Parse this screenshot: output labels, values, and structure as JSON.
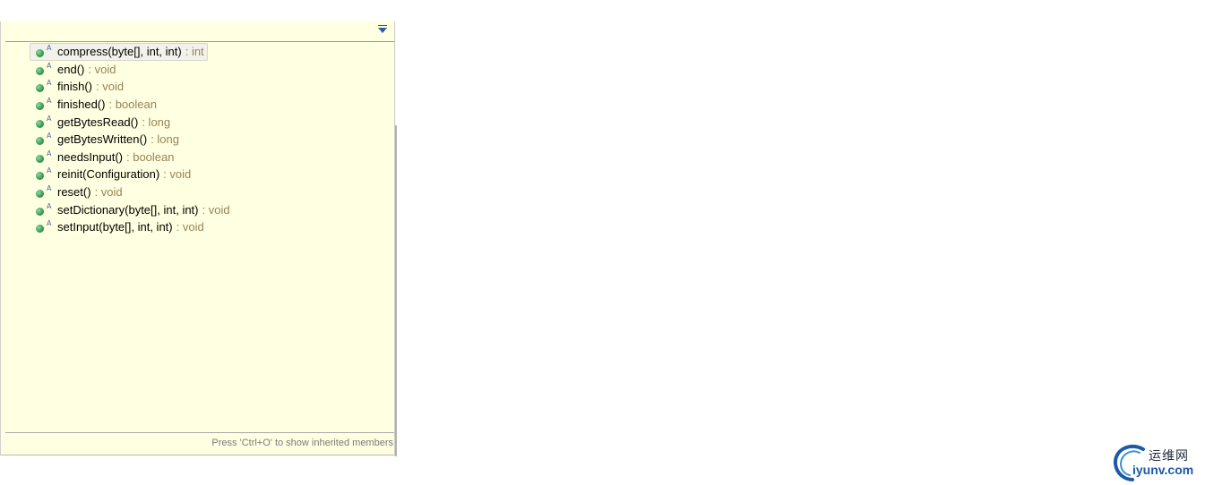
{
  "outline": {
    "filter_value": "",
    "view_menu_icon": "chevron-down-icon",
    "method_icon": "public-method-icon",
    "abstract_marker": "A",
    "colors": {
      "background": "#ffffe1",
      "return_type": "#96845a",
      "method_icon": "#3c9d58"
    },
    "methods": [
      {
        "signature": "compress(byte[], int, int)",
        "return": ": int",
        "selected": true
      },
      {
        "signature": "end()",
        "return": ": void"
      },
      {
        "signature": "finish()",
        "return": ": void"
      },
      {
        "signature": "finished()",
        "return": ": boolean"
      },
      {
        "signature": "getBytesRead()",
        "return": ": long"
      },
      {
        "signature": "getBytesWritten()",
        "return": ": long"
      },
      {
        "signature": "needsInput()",
        "return": ": boolean"
      },
      {
        "signature": "reinit(Configuration)",
        "return": ": void"
      },
      {
        "signature": "reset()",
        "return": ": void"
      },
      {
        "signature": "setDictionary(byte[], int, int)",
        "return": ": void"
      },
      {
        "signature": "setInput(byte[], int, int)",
        "return": ": void"
      }
    ],
    "status_text": "Press 'Ctrl+O' to show inherited members"
  },
  "watermark": {
    "cn": "运维网",
    "en": "iyunv.com"
  }
}
